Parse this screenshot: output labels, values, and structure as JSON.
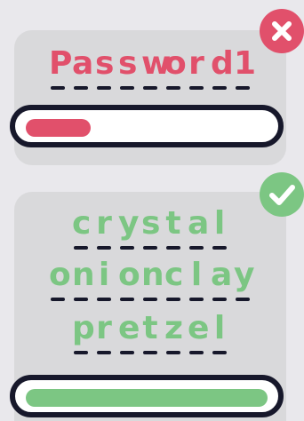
{
  "weak_example": {
    "password_chars": [
      "P",
      "a",
      "s",
      "s",
      "w",
      "o",
      "r",
      "d",
      "1"
    ],
    "status_icon": "x-icon",
    "strength": 0.27,
    "color": "#e1506b"
  },
  "strong_example": {
    "words": [
      [
        "c",
        "r",
        "y",
        "s",
        "t",
        "a",
        "l"
      ],
      [
        "o",
        "n",
        "i",
        "o",
        "n",
        "c",
        "l",
        "a",
        "y"
      ],
      [
        "p",
        "r",
        "e",
        "t",
        "z",
        "e",
        "l"
      ]
    ],
    "status_icon": "check-icon",
    "strength": 1.0,
    "color": "#7cc683"
  }
}
